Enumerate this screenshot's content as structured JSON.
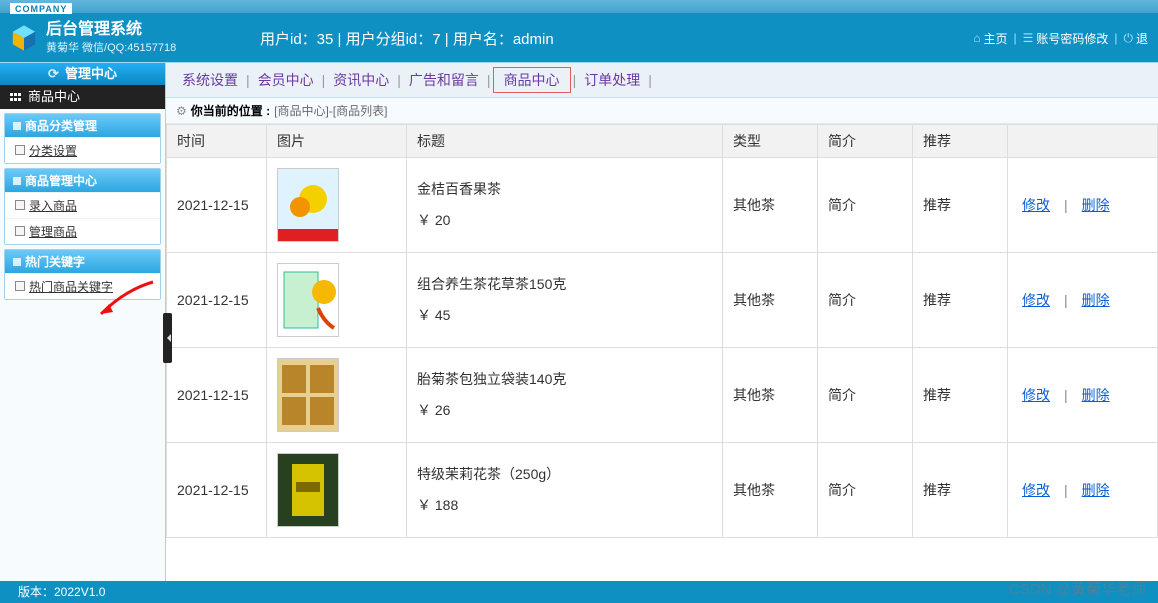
{
  "brand": {
    "company_tag": "COMPANY",
    "title": "后台管理系统",
    "subtitle": "黄菊华 微信/QQ:45157718"
  },
  "user_info": "用户id：35 | 用户分组id：7 | 用户名：admin",
  "header_links": {
    "home": "主页",
    "pwd": "账号密码修改",
    "logout": "退"
  },
  "sidebar": {
    "center": "管理中心",
    "module": "商品中心",
    "groups": [
      {
        "title": "商品分类管理",
        "items": [
          "分类设置"
        ]
      },
      {
        "title": "商品管理中心",
        "items": [
          "录入商品",
          "管理商品"
        ]
      },
      {
        "title": "热门关键字",
        "items": [
          "热门商品关键字"
        ]
      }
    ]
  },
  "nav": {
    "items": [
      "系统设置",
      "会员中心",
      "资讯中心",
      "广告和留言",
      "商品中心",
      "订单处理"
    ],
    "active_index": 4
  },
  "breadcrumb": {
    "label": "你当前的位置",
    "path": "[商品中心]-[商品列表]"
  },
  "table": {
    "headers": {
      "time": "时间",
      "img": "图片",
      "title": "标题",
      "type": "类型",
      "intro": "简介",
      "rec": "推荐",
      "ops": ""
    },
    "intro_text": "简介",
    "rec_text": "推荐",
    "edit": "修改",
    "delete": "删除",
    "rows": [
      {
        "date": "2021-12-15",
        "title": "金桔百香果茶",
        "price": "￥ 20",
        "type": "其他茶",
        "img": "img1"
      },
      {
        "date": "2021-12-15",
        "title": "组合养生茶花草茶150克",
        "price": "￥ 45",
        "type": "其他茶",
        "img": "img2"
      },
      {
        "date": "2021-12-15",
        "title": "胎菊茶包独立袋装140克",
        "price": "￥ 26",
        "type": "其他茶",
        "img": "img3"
      },
      {
        "date": "2021-12-15",
        "title": "特级茉莉花茶（250g）",
        "price": "￥ 188",
        "type": "其他茶",
        "img": "img4"
      }
    ]
  },
  "footer": {
    "version": "版本：2022V1.0"
  },
  "watermark": "CSDN @黄菊华老师"
}
